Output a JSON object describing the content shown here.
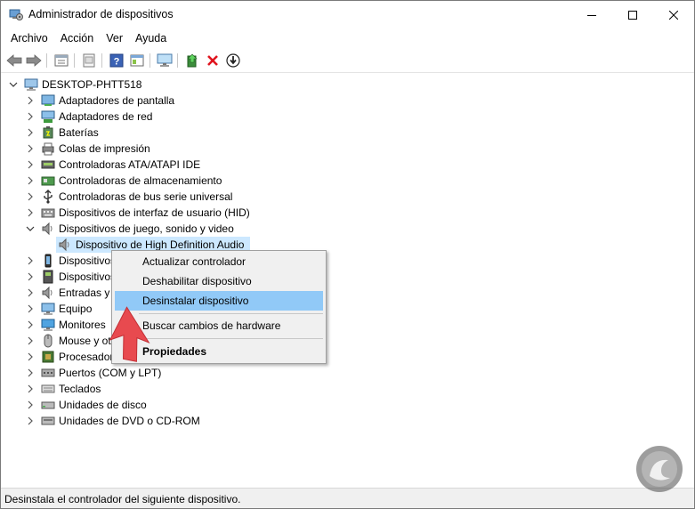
{
  "window": {
    "title": "Administrador de dispositivos",
    "icon": "device-manager-icon"
  },
  "menu": [
    "Archivo",
    "Acción",
    "Ver",
    "Ayuda"
  ],
  "toolbar": {
    "buttons": [
      "back-arrow-icon",
      "forward-arrow-icon",
      "properties-icon",
      "view-icon",
      "help-icon",
      "show-hidden-icon",
      "monitor-scan-icon",
      "update-driver-icon",
      "uninstall-x-icon",
      "download-icon"
    ]
  },
  "tree": {
    "root": "DESKTOP-PHTT518",
    "items": [
      {
        "label": "Adaptadores de pantalla",
        "icon": "display-adapter-icon"
      },
      {
        "label": "Adaptadores de red",
        "icon": "network-adapter-icon"
      },
      {
        "label": "Baterías",
        "icon": "battery-icon"
      },
      {
        "label": "Colas de impresión",
        "icon": "printer-icon"
      },
      {
        "label": "Controladoras ATA/ATAPI IDE",
        "icon": "ide-controller-icon"
      },
      {
        "label": "Controladoras de almacenamiento",
        "icon": "storage-controller-icon"
      },
      {
        "label": "Controladoras de bus serie universal",
        "icon": "usb-icon"
      },
      {
        "label": "Dispositivos de interfaz de usuario (HID)",
        "icon": "hid-icon"
      },
      {
        "label": "Dispositivos de juego, sonido y video",
        "icon": "speaker-icon",
        "expanded": true
      },
      {
        "label": "Dispositivo de High Definition Audio",
        "icon": "speaker-icon",
        "child": true,
        "selected": true
      },
      {
        "label": "Dispositivos",
        "icon": "phone-icon"
      },
      {
        "label": "Dispositivos",
        "icon": "software-device-icon"
      },
      {
        "label": "Entradas y s",
        "icon": "audio-io-icon"
      },
      {
        "label": "Equipo",
        "icon": "computer-icon"
      },
      {
        "label": "Monitores",
        "icon": "monitor-icon"
      },
      {
        "label": "Mouse y ot",
        "icon": "mouse-icon"
      },
      {
        "label": "Procesador",
        "icon": "processor-icon"
      },
      {
        "label": "Puertos (COM y LPT)",
        "icon": "port-icon"
      },
      {
        "label": "Teclados",
        "icon": "keyboard-icon"
      },
      {
        "label": "Unidades de disco",
        "icon": "disk-drive-icon"
      },
      {
        "label": "Unidades de DVD o CD-ROM",
        "icon": "dvd-drive-icon"
      }
    ]
  },
  "context_menu": {
    "items": [
      {
        "label": "Actualizar controlador"
      },
      {
        "label": "Deshabilitar dispositivo"
      },
      {
        "label": "Desinstalar dispositivo",
        "highlighted": true
      },
      {
        "label": "Buscar cambios de hardware"
      },
      {
        "label": "Propiedades",
        "bold": true
      }
    ]
  },
  "status": "Desinstala el controlador del siguiente dispositivo.",
  "colors": {
    "selection": "#cce8ff",
    "menu_highlight": "#91c9f7",
    "arrow": "#e84a4f",
    "uninstall_x": "#e0141e"
  }
}
